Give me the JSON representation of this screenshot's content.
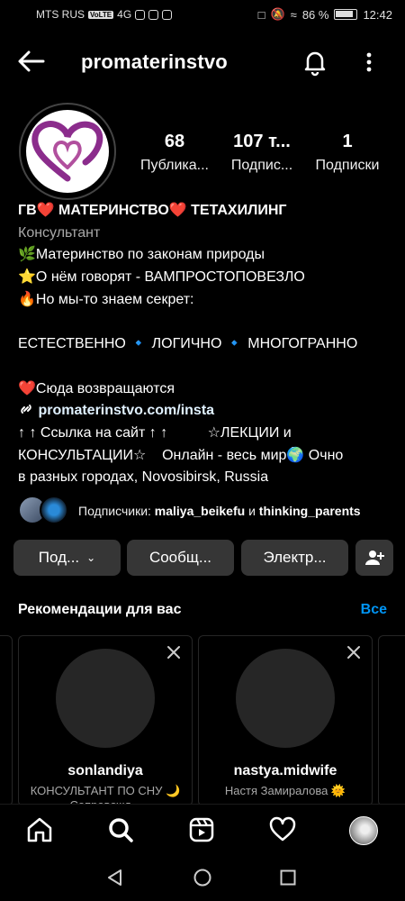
{
  "statusbar": {
    "carrier": "MTS RUS",
    "volte": "VoLTE",
    "network": "4G",
    "battery": "86 %",
    "time": "12:42"
  },
  "header": {
    "username": "promaterinstvo",
    "icons": [
      "back-arrow-icon",
      "bell-icon",
      "more-vertical-icon"
    ]
  },
  "stats": [
    {
      "value": "68",
      "label": "Публика..."
    },
    {
      "value": "107 т...",
      "label": "Подпис..."
    },
    {
      "value": "1",
      "label": "Подписки"
    }
  ],
  "bio": {
    "name": "ГВ❤️ МАТЕРИНСТВО❤️ ТЕТАХИЛИНГ",
    "category": "Консультант",
    "lines": [
      "🌿Материнство по законам природы",
      "⭐О нём говорят - ВАМПРОСТОПОВЕЗЛО",
      "🔥Но мы-то знаем секрет:",
      "",
      "ЕСТЕСТВЕННО 🔹 ЛОГИЧНО 🔹 МНОГОГРАННО",
      "",
      "❤️Сюда возвращаются"
    ],
    "link": "promaterinstvo.com/insta",
    "tail_lines": [
      "↑ ↑ Ссылка на сайт ↑ ↑          ☆ЛЕКЦИИ и",
      "КОНСУЛЬТАЦИИ☆    Онлайн - весь мир🌍 Очно",
      "в разных городах, Novosibirsk, Russia"
    ]
  },
  "followed_by": {
    "prefix": "Подписчики:",
    "user1": "maliya_beikefu",
    "conj": "и",
    "user2": "thinking_parents"
  },
  "actions": {
    "follow": "Под...",
    "message": "Сообщ...",
    "email": "Электр...",
    "add_user_icon": "add-user-icon"
  },
  "recommendations": {
    "title": "Рекомендации для вас",
    "see_all": "Все",
    "cards": [
      {
        "name": "sonlandiya",
        "subtitle": "КОНСУЛЬТАНТ ПО СНУ 🌙 Сопровожд..."
      },
      {
        "name": "nastya.midwife",
        "subtitle": "Настя Замиралова 🌞"
      }
    ]
  },
  "colors": {
    "background": "#000000",
    "button": "#363636",
    "link_blue": "#0095f6",
    "muted": "#a8a8a8",
    "logo_purple": "#8b2c8c"
  },
  "bottom_nav": [
    "home-icon",
    "search-icon",
    "reels-icon",
    "heart-icon",
    "profile-avatar"
  ]
}
